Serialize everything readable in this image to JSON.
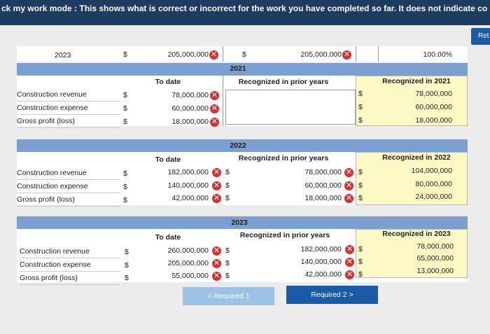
{
  "banner": "ck my work mode : This shows what is correct or incorrect for the work you have completed so far. It does not indicate co",
  "return_label": "Ret",
  "top_row": {
    "year": "2023",
    "dollar1": "$",
    "value1": "205,000,000",
    "dollar2": "$",
    "value2": "205,000,000",
    "percent": "100.00%"
  },
  "headers": {
    "to_date": "To date",
    "prior_years": "Recognized in prior years"
  },
  "row_labels": [
    "Construction revenue",
    "Construction expense",
    "Gross profit (loss)"
  ],
  "section_2021": {
    "year": "2021",
    "current_header": "Recognized in 2021",
    "labels": [
      "Construction revenue",
      "Construction expense",
      "Gross profit (loss)"
    ],
    "to_date": [
      "78,000,000",
      "60,000,000",
      "18,000,000"
    ],
    "current": [
      "78,000,000",
      "60,000,000",
      "18,000,000"
    ]
  },
  "section_2022": {
    "year": "2022",
    "current_header": "Recognized in 2022",
    "labels": [
      "Construction revenue",
      "Construction expense",
      "Gross profit (loss)"
    ],
    "to_date": [
      "182,000,000",
      "140,000,000",
      "42,000,000"
    ],
    "prior": [
      "78,000,000",
      "60,000,000",
      "18,000,000"
    ],
    "current": [
      "104,000,000",
      "80,000,000",
      "24,000,000"
    ]
  },
  "section_2023": {
    "year": "2023",
    "current_header": "Recognized in 2023",
    "labels": [
      "Construction revenue",
      "Construction expense",
      "Gross profit (loss)"
    ],
    "to_date": [
      "260,000,000",
      "205,000,000",
      "55,000,000"
    ],
    "prior": [
      "182,000,000",
      "140,000,000",
      "42,000,000"
    ],
    "current": [
      "78,000,000",
      "65,000,000",
      "13,000,000"
    ]
  },
  "dollar": "$",
  "incorrect_mark": "✕",
  "nav": {
    "prev_label": "< Required 1",
    "next_label": "Required 2 >"
  }
}
